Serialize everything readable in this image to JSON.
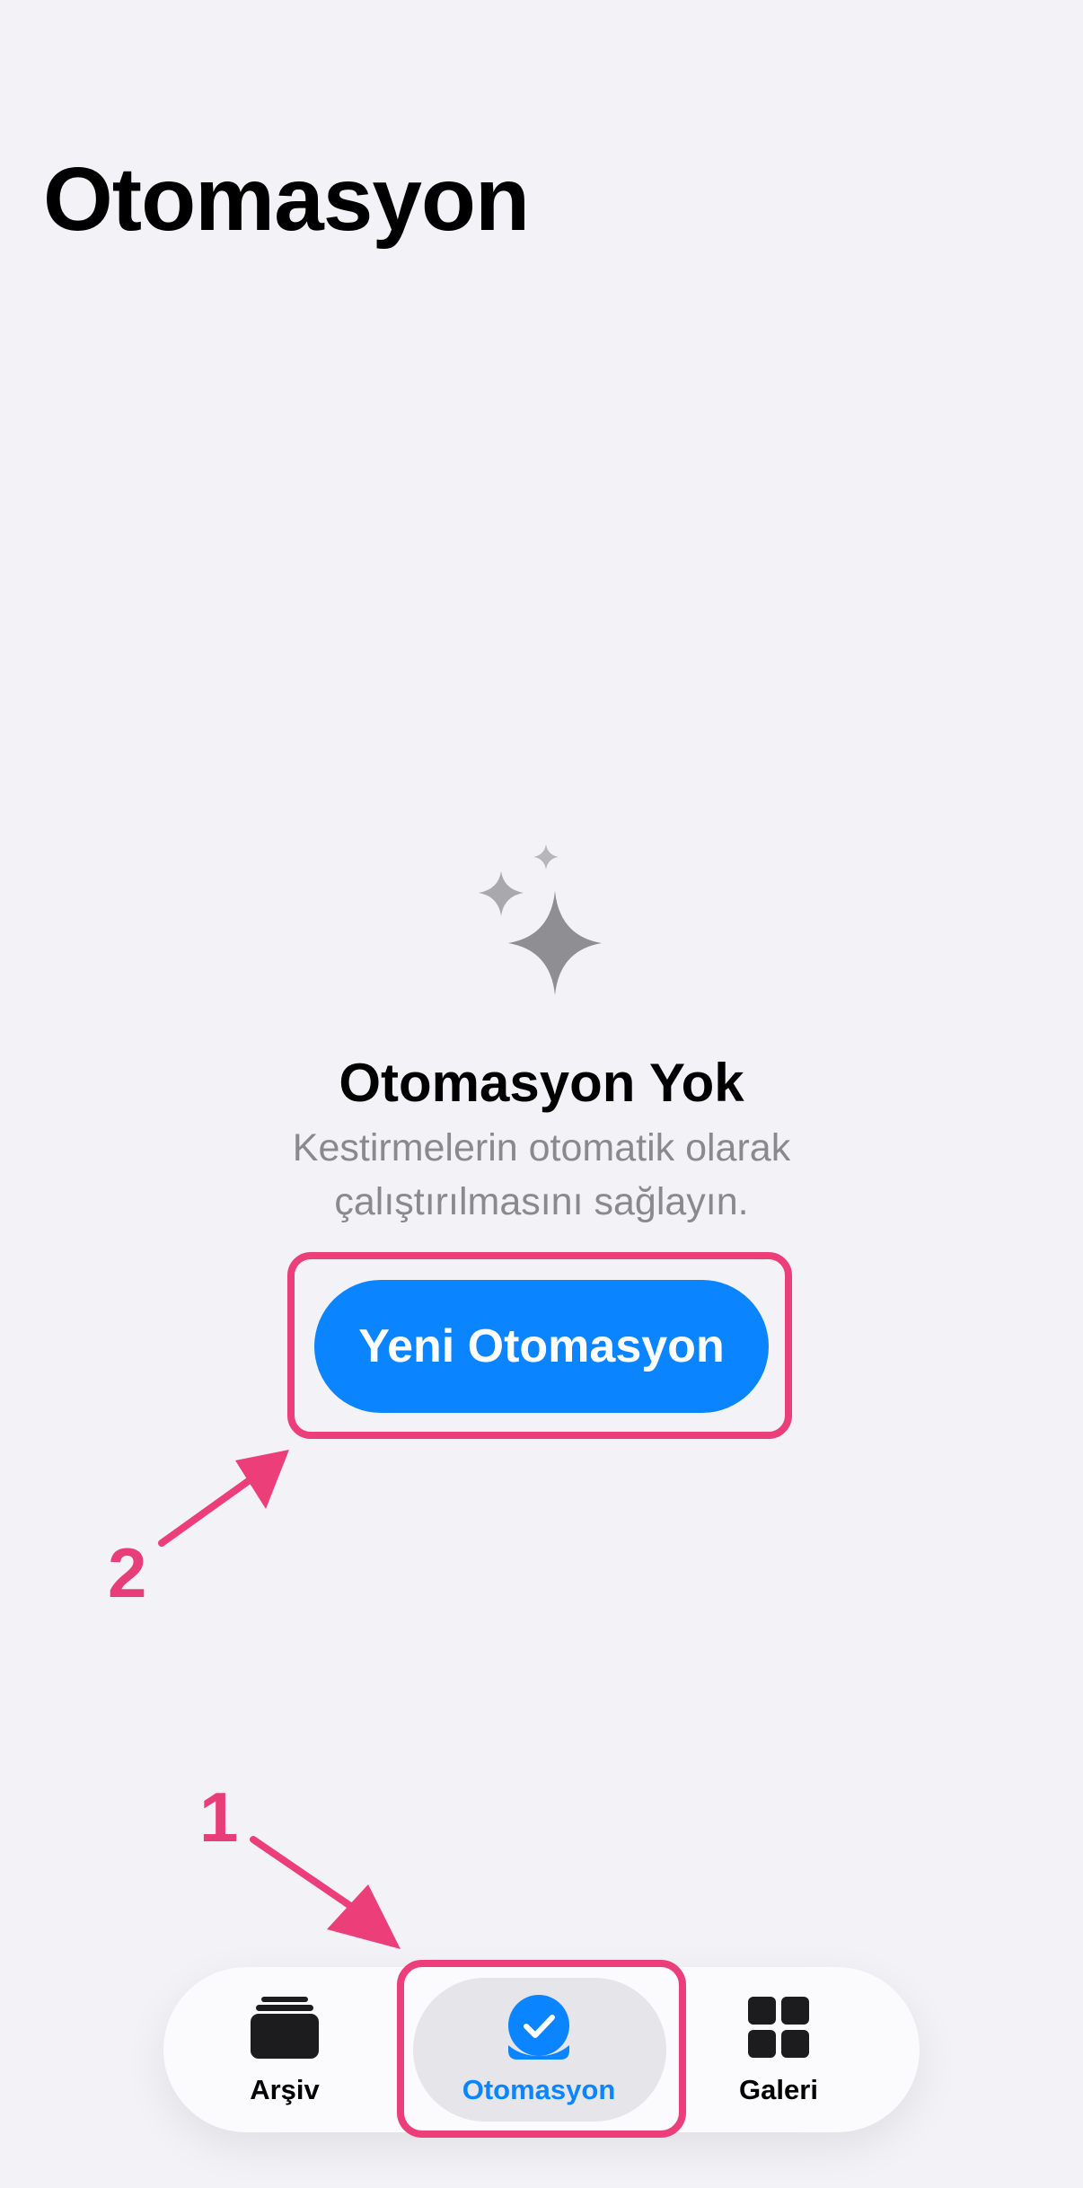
{
  "header": {
    "title": "Otomasyon"
  },
  "empty_state": {
    "icon": "sparkles-icon",
    "title": "Otomasyon Yok",
    "subtitle": "Kestirmelerin otomatik olarak çalıştırılmasını sağlayın.",
    "button_label": "Yeni Otomasyon"
  },
  "annotations": {
    "step_1": "1",
    "step_2": "2",
    "color": "#ec3f7a"
  },
  "tab_bar": {
    "items": [
      {
        "label": "Arşiv",
        "icon": "archive-icon",
        "active": false
      },
      {
        "label": "Otomasyon",
        "icon": "automation-check-icon",
        "active": true
      },
      {
        "label": "Galeri",
        "icon": "gallery-grid-icon",
        "active": false
      }
    ]
  },
  "colors": {
    "accent": "#0a84ff",
    "background": "#f2f2f7",
    "icon_gray": "#8e8e93"
  }
}
